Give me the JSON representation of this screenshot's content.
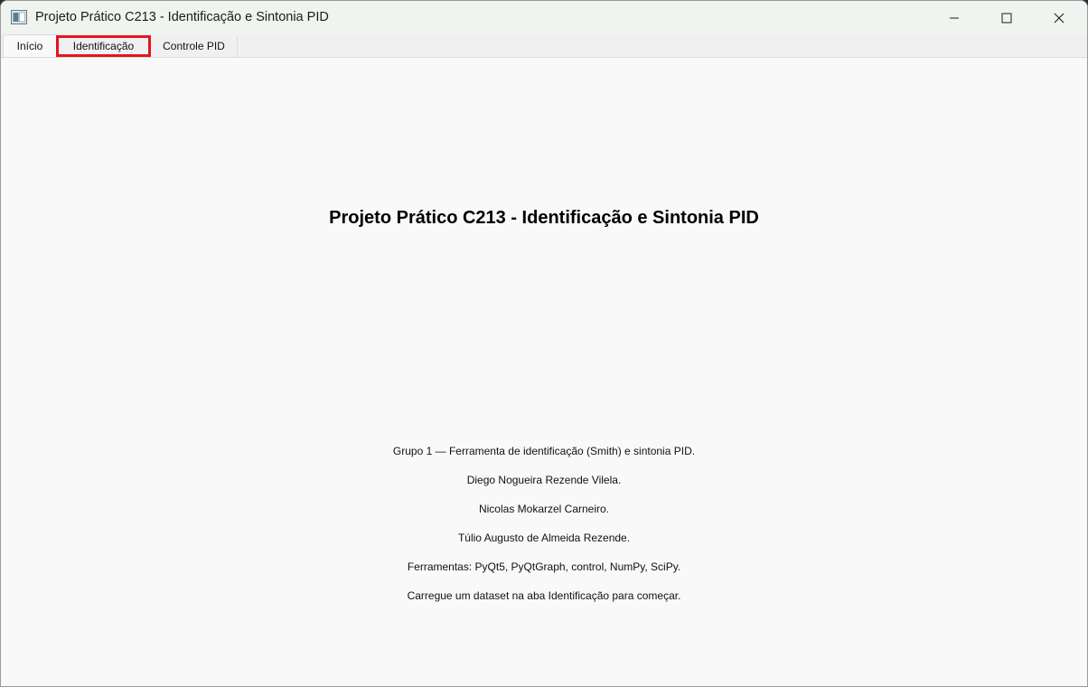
{
  "window": {
    "title": "Projeto Prático C213 - Identificação e Sintonia PID",
    "controls": {
      "minimize_icon": "minimize-icon",
      "maximize_icon": "maximize-icon",
      "close_icon": "close-icon"
    }
  },
  "tabs": [
    {
      "label": "Início",
      "active": true
    },
    {
      "label": "Identificação",
      "active": false,
      "highlighted": true
    },
    {
      "label": "Controle PID",
      "active": false
    }
  ],
  "main": {
    "title": "Projeto Prático C213 - Identificação e Sintonia PID",
    "lines": [
      "Grupo 1 — Ferramenta de identificação (Smith) e sintonia PID.",
      "Diego Nogueira Rezende Vilela.",
      "Nicolas Mokarzel Carneiro.",
      "Túlio Augusto de Almeida Rezende.",
      "Ferramentas: PyQt5, PyQtGraph, control, NumPy, SciPy.",
      "Carregue um dataset na aba Identificação para começar."
    ]
  },
  "colors": {
    "highlight_border": "#e3161d",
    "window_bg": "#f9f9f9",
    "titlebar_bg": "#f0f4f0"
  }
}
